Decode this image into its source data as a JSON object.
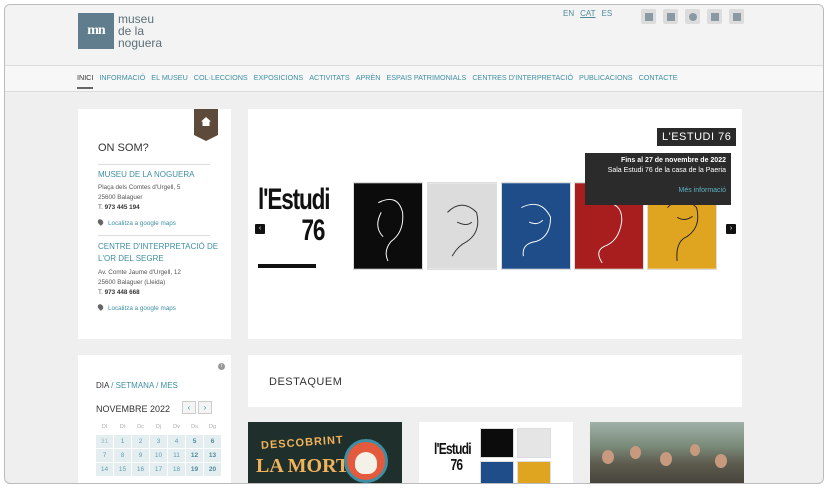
{
  "header": {
    "logo_mark": "mn",
    "logo_line1": "museu",
    "logo_line2": "de la",
    "logo_line3": "noguera",
    "languages": [
      {
        "label": "EN",
        "active": false
      },
      {
        "label": "CAT",
        "active": true
      },
      {
        "label": "ES",
        "active": false
      }
    ],
    "icons": [
      "youtube-icon",
      "facebook-icon",
      "twitter-icon",
      "calendar-icon",
      "tag-icon"
    ]
  },
  "nav": {
    "items": [
      "INICI",
      "INFORMACIÓ",
      "EL MUSEU",
      "COL·LECCIONS",
      "EXPOSICIONS",
      "ACTIVITATS",
      "APRÈN",
      "ESPAIS PATRIMONIALS",
      "CENTRES D'INTERPRETACIÓ",
      "PUBLICACIONS",
      "CONTACTE"
    ],
    "active": "INICI"
  },
  "onsom": {
    "title": "ON SOM?",
    "places": [
      {
        "name": "MUSEU DE LA NOGUERA",
        "address1": "Plaça dels Comtes d'Urgell, 5",
        "address2": "25600 Balaguer",
        "phone_prefix": "T.",
        "phone": "973 445 194",
        "maps_link": "Localitza a google maps"
      },
      {
        "name": "CENTRE D'INTERPRETACIÓ DE L'OR DEL SEGRE",
        "address1": "Av. Comte Jaume d'Urgell, 12",
        "address2": "25600 Balaguer (Lleida)",
        "phone_prefix": "T.",
        "phone": "973 448 668",
        "maps_link": "Localitza a google maps"
      }
    ]
  },
  "slider": {
    "poster_line1": "l'Estudi",
    "poster_line2": "76",
    "title": "L'ESTUDI 76",
    "date": "Fins al 27 de novembre de 2022",
    "place": "Sala Estudi 76 de la casa de la Paeria",
    "more": "Més informació",
    "prev": "‹",
    "next": "›",
    "art_colors": [
      "#0c0c0c",
      "#dcdcdc",
      "#1f4d8a",
      "#a81d1d",
      "#e0a520"
    ]
  },
  "calendar": {
    "info": "i",
    "tab_day": "DIA",
    "tab_week": "SETMANA",
    "tab_month": "MES",
    "separator": "/",
    "month": "NOVEMBRE 2022",
    "prev": "‹",
    "next": "›",
    "weekdays": [
      "Dl",
      "Dt",
      "Dc",
      "Dj",
      "Dv",
      "Ds",
      "Dg"
    ],
    "rows": [
      [
        "31",
        "1",
        "2",
        "3",
        "4",
        "5",
        "6"
      ],
      [
        "7",
        "8",
        "9",
        "10",
        "11",
        "12",
        "13"
      ],
      [
        "14",
        "15",
        "16",
        "17",
        "18",
        "19",
        "20"
      ]
    ]
  },
  "destaquem": {
    "title": "DESTAQUEM",
    "card1_line1": "DESCOBRINT",
    "card1_line2": "LA MORT",
    "card2_line1": "l'Estudi",
    "card2_line2": "76"
  }
}
